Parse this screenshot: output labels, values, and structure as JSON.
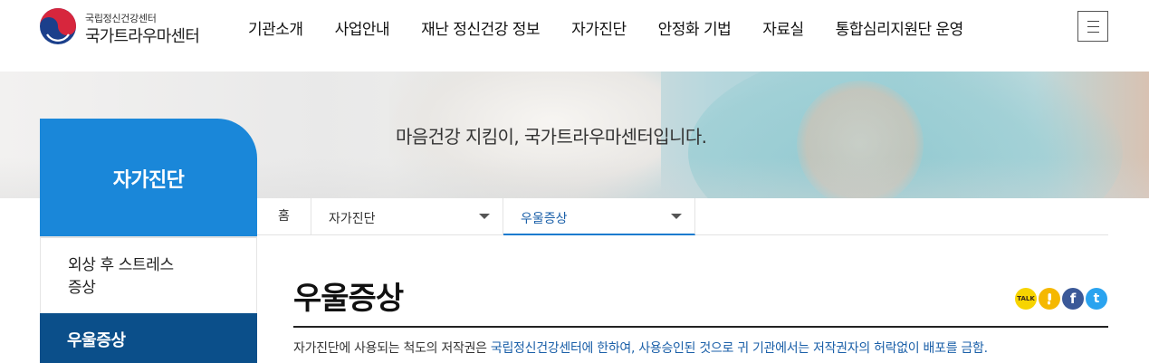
{
  "logo": {
    "sub": "국립정신건강센터",
    "main": "국가트라우마센터",
    "colors": {
      "red": "#d7263d",
      "blue": "#1b3f8b"
    }
  },
  "nav": {
    "items": [
      {
        "label": "기관소개"
      },
      {
        "label": "사업안내"
      },
      {
        "label": "재난 정신건강 정보"
      },
      {
        "label": "자가진단"
      },
      {
        "label": "안정화 기법"
      },
      {
        "label": "자료실"
      },
      {
        "label": "통합심리지원단 운영"
      }
    ],
    "menu_icon": "hamburger-icon"
  },
  "hero": {
    "tagline": "마음건강 지킴이, 국가트라우마센터입니다."
  },
  "sidebar": {
    "title": "자가진단",
    "items": [
      {
        "label_line1": "외상 후 스트레스",
        "label_line2": "증상"
      },
      {
        "label": "우울증상",
        "active": true
      }
    ],
    "accent": "#1a87d9",
    "active_color": "#0b4f8a"
  },
  "breadcrumb": {
    "home": "홈",
    "level1": "자가진단",
    "level2": "우울증상"
  },
  "content": {
    "title": "우울증상",
    "share": [
      {
        "icon": "kakaotalk-icon",
        "text": "TALK",
        "color": "#f7d400"
      },
      {
        "icon": "kakaostory-icon",
        "text": "",
        "color": "#f5b800"
      },
      {
        "icon": "facebook-icon",
        "text": "f",
        "color": "#3b5998"
      },
      {
        "icon": "twitter-icon",
        "text": "t",
        "color": "#2aa3ef"
      }
    ],
    "notice_prefix": "자가진단에 사용되는 척도의 저작권은 ",
    "notice_highlight": "국립정신건강센터에 한하여, 사용승인된 것으로 귀 기관에서는 저작권자의 허락없이 배포를 금함."
  }
}
